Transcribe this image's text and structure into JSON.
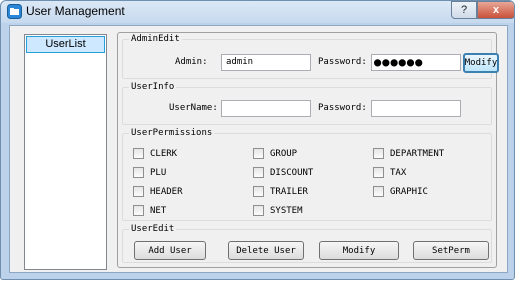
{
  "window": {
    "title": "User Management",
    "help_label": "?",
    "close_label": "x"
  },
  "userlist": {
    "items": [
      "UserList"
    ]
  },
  "admin_edit": {
    "legend": "AdminEdit",
    "admin_label": "Admin:",
    "admin_value": "admin",
    "password_label": "Password:",
    "password_value": "●●●●●●",
    "modify_label": "Modify"
  },
  "user_info": {
    "legend": "UserInfo",
    "username_label": "UserName:",
    "username_value": "",
    "password_label": "Password:",
    "password_value": ""
  },
  "permissions": {
    "legend": "UserPermissions",
    "items": [
      "CLERK",
      "GROUP",
      "DEPARTMENT",
      "PLU",
      "DISCOUNT",
      "TAX",
      "HEADER",
      "TRAILER",
      "GRAPHIC",
      "NET",
      "SYSTEM"
    ]
  },
  "user_edit": {
    "legend": "UserEdit",
    "add_label": "Add User",
    "delete_label": "Delete User",
    "modify_label": "Modify",
    "setperm_label": "SetPerm"
  }
}
